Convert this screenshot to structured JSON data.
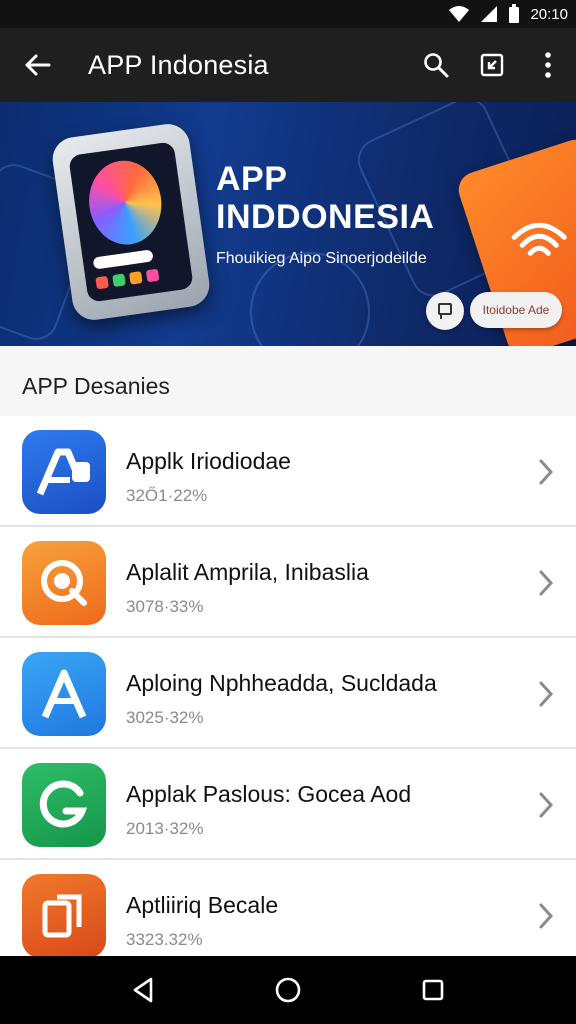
{
  "status_bar": {
    "time": "20:10",
    "icons": [
      "wifi-icon",
      "signal-icon",
      "battery-icon"
    ]
  },
  "toolbar": {
    "title": "APP Indonesia",
    "icons": [
      "back-arrow-icon",
      "search-icon",
      "open-in-icon",
      "more-vertical-icon"
    ]
  },
  "banner": {
    "title_line1": "APP",
    "title_line2": "INDDONESIA",
    "subtitle": "Fhouikieg Aipo Sinoerjodeilde",
    "button_label": "Itoidobe Ade"
  },
  "section": {
    "title": "APP Desanies"
  },
  "apps": [
    {
      "name": "Applk Iriodiodae",
      "meta": "32Ő1·22%",
      "color": "#1f5fd6",
      "icon": "app-store-a-icon"
    },
    {
      "name": "Aplalit Amprila, Inibaslia",
      "meta": "3078·33%",
      "color": "#f07b22",
      "icon": "orange-q-icon"
    },
    {
      "name": "Aploing Nphheadda, Sucldada",
      "meta": "3025·32%",
      "color": "#2b8ef0",
      "icon": "letter-a-icon"
    },
    {
      "name": "Applak Paslous: Gocea Aod",
      "meta": "2013·32%",
      "color": "#1fa556",
      "icon": "green-g-icon"
    },
    {
      "name": "Aptliiriq Becale",
      "meta": "3323.32%",
      "color": "#e45a1e",
      "icon": "copy-icon"
    }
  ],
  "nav": {
    "icons": [
      "back-triangle-icon",
      "home-circle-icon",
      "recents-square-icon"
    ]
  }
}
